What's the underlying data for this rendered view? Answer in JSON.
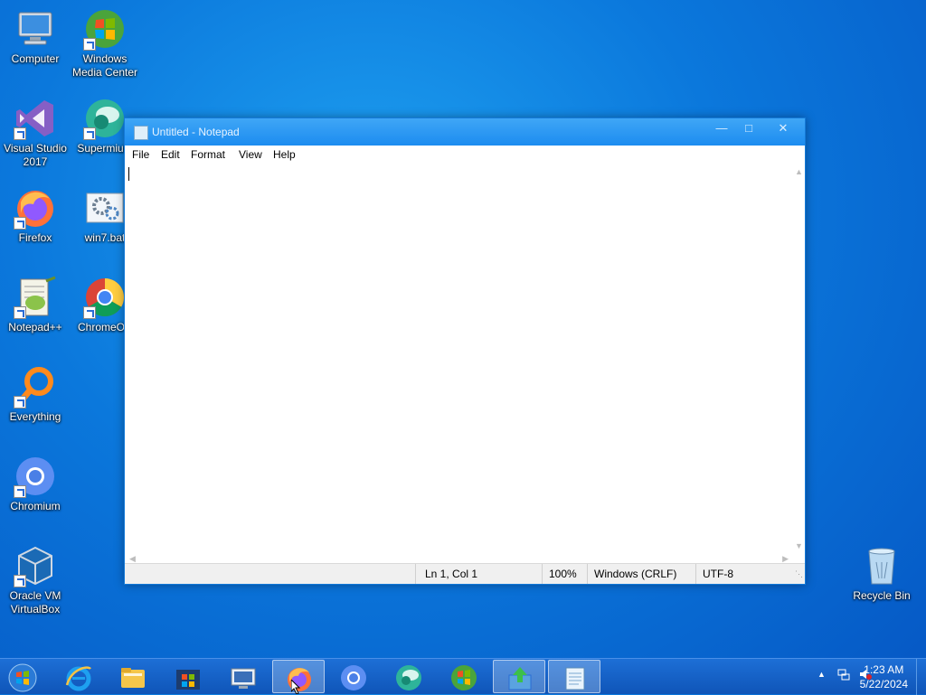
{
  "desktop": {
    "icons": [
      {
        "label": "Computer"
      },
      {
        "label": "Windows Media Center"
      },
      {
        "label": "Visual Studio 2017"
      },
      {
        "label": "Supermium"
      },
      {
        "label": "Firefox"
      },
      {
        "label": "win7.bat"
      },
      {
        "label": "Notepad++"
      },
      {
        "label": "ChromeOS"
      },
      {
        "label": "Everything"
      },
      {
        "label": "Chromium"
      },
      {
        "label": "Oracle VM VirtualBox"
      },
      {
        "label": "Recycle Bin"
      }
    ]
  },
  "notepad": {
    "title": "Untitled - Notepad",
    "menu": [
      "File",
      "Edit",
      "Format",
      "View",
      "Help"
    ],
    "content": "",
    "status": {
      "position": "Ln 1, Col 1",
      "zoom": "100%",
      "line_ending": "Windows (CRLF)",
      "encoding": "UTF-8"
    }
  },
  "taskbar": {
    "clock_time": "1:23 AM",
    "clock_date": "5/22/2024",
    "items": [
      "start-button",
      "internet-explorer",
      "file-explorer",
      "windows-store",
      "remote-desktop",
      "firefox",
      "chromium",
      "supermium",
      "windows-media-center",
      "file-transfer",
      "notepad"
    ]
  },
  "colors": {
    "desktop_bg": "#0b78dc",
    "titlebar": "#1c8cf0",
    "taskbar": "#1560c6"
  }
}
